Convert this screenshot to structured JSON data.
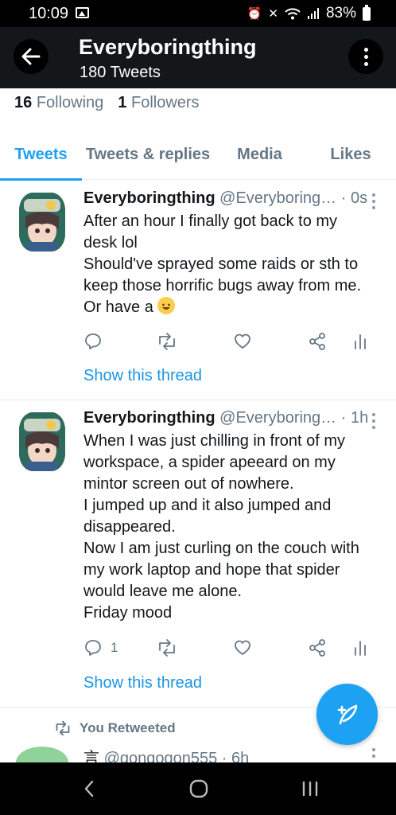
{
  "status_bar": {
    "time": "10:09",
    "battery": "83%",
    "icons": [
      "image-icon",
      "alarm-icon",
      "mute-icon",
      "wifi-icon",
      "signal-icon",
      "battery-icon"
    ]
  },
  "header": {
    "title": "Everyboringthing",
    "subtitle": "180 Tweets"
  },
  "follow_stats": {
    "following_count": "16",
    "following_label": "Following",
    "followers_count": "1",
    "followers_label": "Followers"
  },
  "tabs": [
    {
      "label": "Tweets",
      "active": true
    },
    {
      "label": "Tweets & replies",
      "active": false
    },
    {
      "label": "Media",
      "active": false
    },
    {
      "label": "Likes",
      "active": false
    }
  ],
  "tweets": [
    {
      "name": "Everyboringthing",
      "handle": "@Everyboring…",
      "time": "· 0s",
      "lines": [
        "After an hour I finally got back to my",
        "desk lol",
        "Should've sprayed some raids or sth to",
        "keep those horrific bugs away from me.",
        "Or have a "
      ],
      "reply_count": "",
      "show_thread": "Show this thread"
    },
    {
      "name": "Everyboringthing",
      "handle": "@Everyboring…",
      "time": "· 1h",
      "lines": [
        "When I was just chilling in front of my",
        "workspace, a spider apeeard on my",
        "mintor screen out of nowhere.",
        "I jumped up and it also jumped and",
        "disappeared.",
        "Now I am just curling on the couch with",
        "my work laptop and hope that spider",
        "would leave me alone.",
        "Friday mood"
      ],
      "reply_count": "1",
      "show_thread": "Show this thread"
    }
  ],
  "retweet": {
    "label": "You Retweeted",
    "name_glyph": "言",
    "handle": "@gongogon555",
    "time": "· 6h"
  },
  "colors": {
    "accent": "#1da1f2",
    "header_bg": "#14171a",
    "muted": "#657786"
  }
}
